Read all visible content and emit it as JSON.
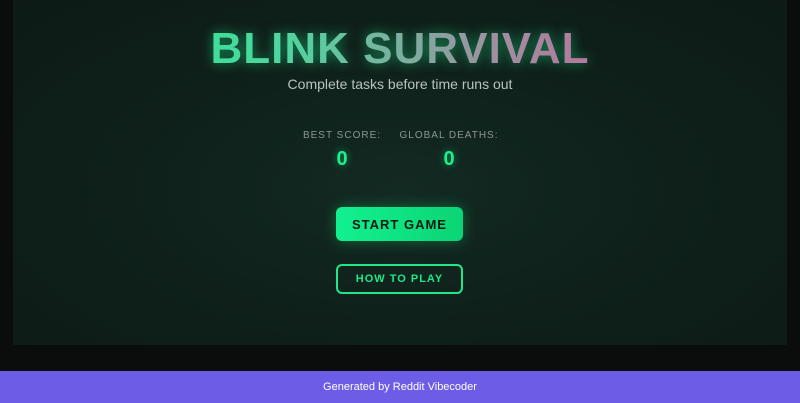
{
  "game": {
    "title": "BLINK SURVIVAL",
    "subtitle": "Complete tasks before time runs out"
  },
  "stats": {
    "best_score_label": "BEST SCORE:",
    "best_score_value": "0",
    "global_deaths_label": "GLOBAL DEATHS:",
    "global_deaths_value": "0"
  },
  "buttons": {
    "start_label": "START GAME",
    "how_to_play_label": "HOW TO PLAY"
  },
  "footer": {
    "text": "Generated by Reddit Vibecoder"
  },
  "colors": {
    "accent_green": "#1ef08c",
    "title_gradient_end": "#e04a9a",
    "footer_bg": "#6d5ce6",
    "panel_bg": "#0f211b"
  }
}
